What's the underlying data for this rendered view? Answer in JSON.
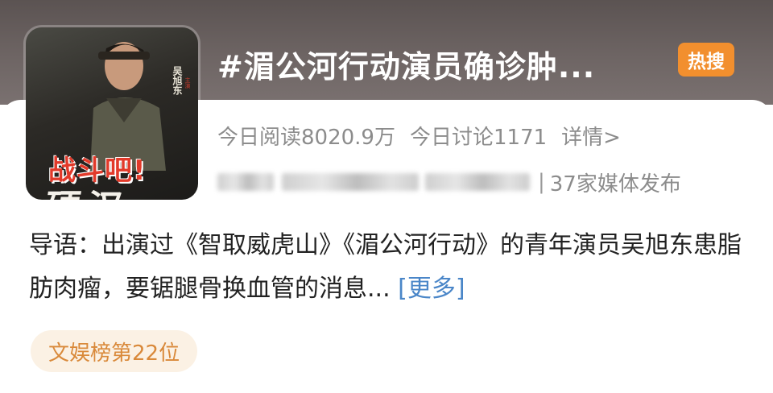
{
  "topic": {
    "title": "#湄公河行动演员确诊肿...",
    "badge": "热搜",
    "colors": {
      "badge_bg": "#f28f2e",
      "more_link": "#4a86c8",
      "rank_tag_text": "#d9893a"
    }
  },
  "cover": {
    "red_text": "战斗吧!",
    "white_text": "硬汉",
    "name_text": "吴旭东",
    "small_text": "主演"
  },
  "stats": {
    "reads": "今日阅读8020.9万",
    "discussions": "今日讨论1171",
    "detail": "详情>"
  },
  "sources": {
    "separator": "|",
    "media_count": "37家媒体发布"
  },
  "intro": {
    "text": "导语：出演过《智取威虎山》《湄公河行动》的青年演员吴旭东患脂肪肉瘤，要锯腿骨换血管的消息...",
    "more": "[更多]"
  },
  "rank": {
    "label": "文娱榜第22位"
  }
}
